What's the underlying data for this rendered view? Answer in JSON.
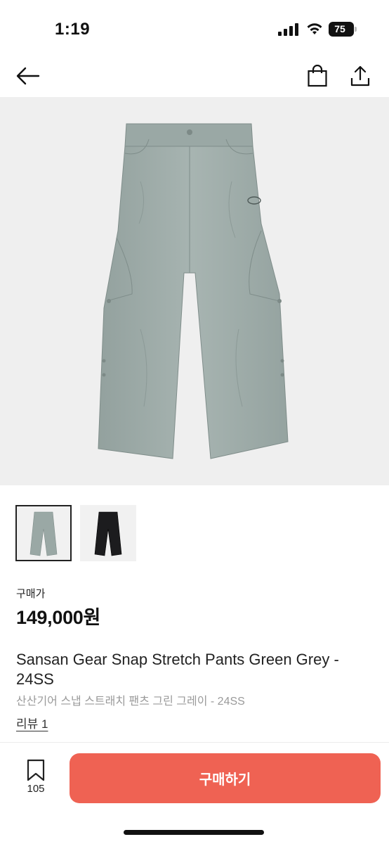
{
  "status_bar": {
    "time": "1:19",
    "battery_level": "75"
  },
  "nav": {
    "back_icon": "arrow-left-icon",
    "bag_icon": "shopping-bag-icon",
    "share_icon": "share-icon"
  },
  "gallery": {
    "main_image_alt": "pants",
    "thumbnails": [
      {
        "color": "#9aa8a5",
        "selected": true
      },
      {
        "color": "#1c1c1e",
        "selected": false
      }
    ]
  },
  "price": {
    "label": "구매가",
    "value": "149,000원"
  },
  "product": {
    "title": "Sansan Gear Snap Stretch Pants Green Grey - 24SS",
    "subtitle": "산산기어 스냅 스트래치 팬츠 그린 그레이 - 24SS",
    "review_link": "리뷰 1"
  },
  "bottom_bar": {
    "bookmark_count": "105",
    "buy_label": "구매하기",
    "buy_color": "#ef6253"
  }
}
